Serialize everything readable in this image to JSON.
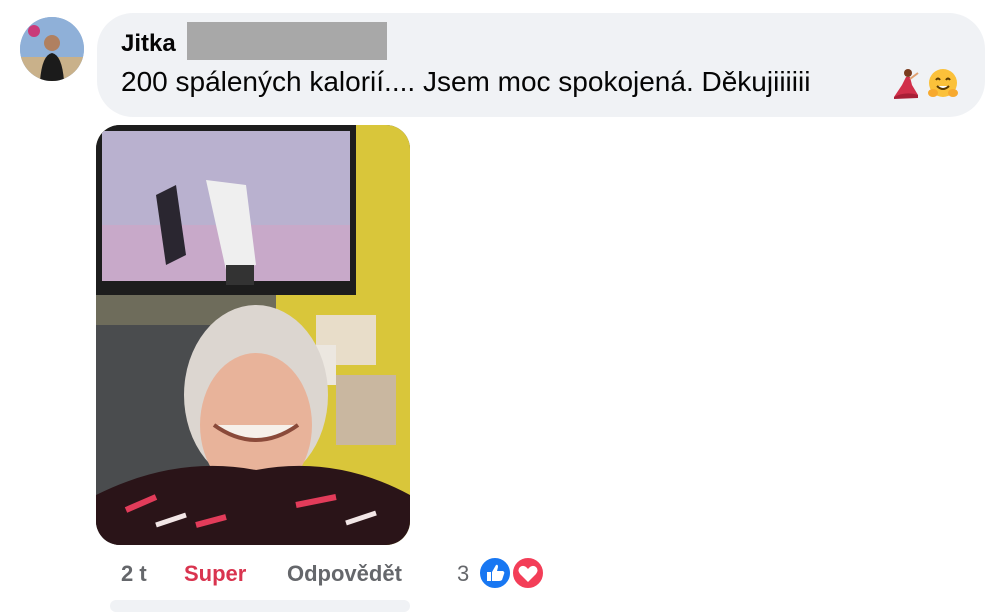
{
  "comment": {
    "author": "Jitka",
    "text": "200 spálených kalorií.... Jsem moc spokojená. Děkujiiiiii",
    "emojis": [
      "dancer-emoji",
      "hugging-face-emoji"
    ]
  },
  "actions": {
    "time": "2 t",
    "reaction_label": "Super",
    "reply_label": "Odpovědět",
    "reaction_count": "3",
    "reaction_icons": [
      "like-icon",
      "love-icon"
    ]
  },
  "colors": {
    "bubble": "#f0f2f5",
    "like": "#1877f2",
    "love": "#f33e58",
    "super": "#d9344f"
  }
}
